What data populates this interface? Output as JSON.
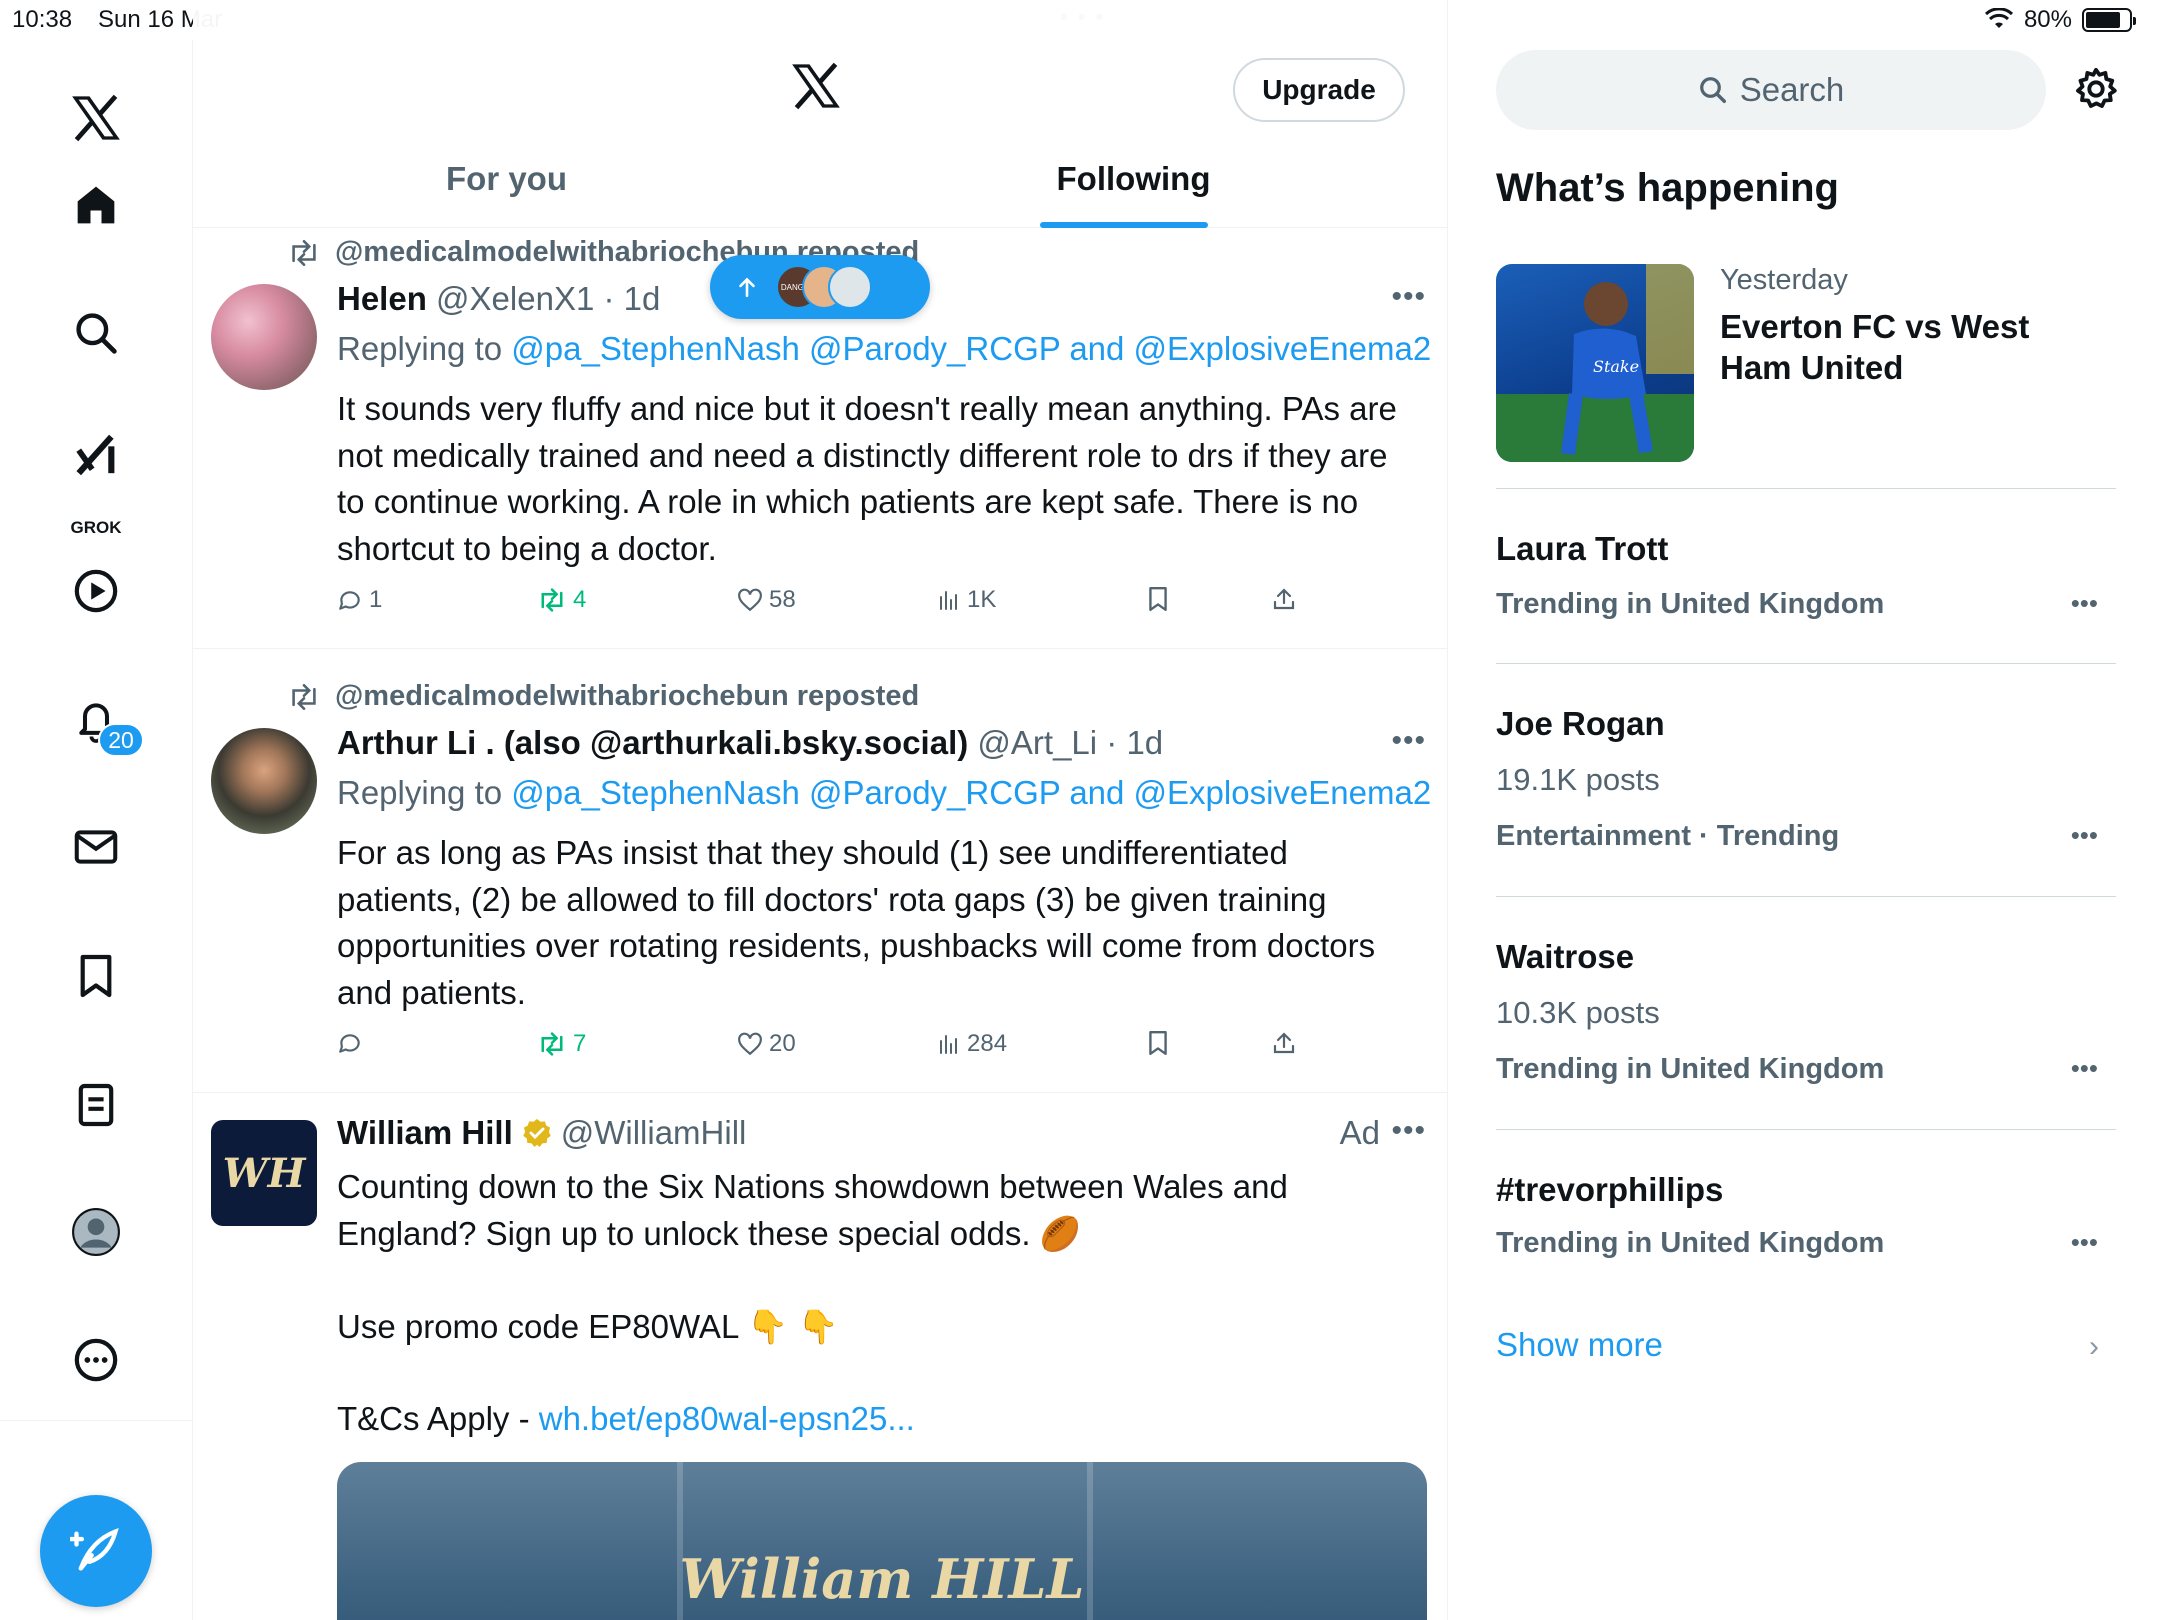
{
  "status_bar": {
    "time": "10:38",
    "date": "Sun 16 Mar",
    "battery": "80%",
    "battery_level": 0.8
  },
  "nav": {
    "items": [
      "x-logo",
      "home",
      "explore",
      "grok",
      "video",
      "notifications",
      "messages",
      "bookmarks",
      "lists",
      "profile",
      "more"
    ],
    "grok_label": "GROK",
    "notifications_count": "20"
  },
  "header": {
    "upgrade_label": "Upgrade",
    "tabs": [
      {
        "label": "For you",
        "active": false
      },
      {
        "label": "Following",
        "active": true
      }
    ]
  },
  "new_posts_pill": {
    "avatar_text": "DANGER"
  },
  "feed": [
    {
      "repost_line": "@medicalmodelwithabriochebun reposted",
      "name": "Helen",
      "handle": "@XelenX1",
      "time": "· 1d",
      "reply_prefix": "Replying to",
      "reply_to": "@pa_StephenNash @Parody_RCGP and @ExplosiveEnema2",
      "text": "It sounds very fluffy and nice but it doesn't really mean anything. PAs are not medically trained and need a distinctly different role to drs if they are to continue working. A role in which patients are kept safe. There is no shortcut to being a doctor.",
      "replies": "1",
      "reposts": "4",
      "likes": "58",
      "views": "1K"
    },
    {
      "repost_line": "@medicalmodelwithabriochebun reposted",
      "name": "Arthur Li . (also @arthurkali.bsky.social)",
      "handle": "@Art_Li",
      "time": "· 1d",
      "reply_prefix": "Replying to",
      "reply_to": "@pa_StephenNash @Parody_RCGP and @ExplosiveEnema2",
      "text": "For as long as PAs insist that they should (1) see undifferentiated patients, (2) be allowed to fill doctors' rota gaps (3) be given training opportunities over rotating residents, pushbacks will come from doctors and patients.",
      "replies": "",
      "reposts": "7",
      "likes": "20",
      "views": "284"
    },
    {
      "name": "William Hill",
      "handle": "@WilliamHill",
      "ad_label": "Ad",
      "avatar_text": "WH",
      "text_line1": "Counting down to the Six Nations showdown between Wales and England? Sign up to unlock these special odds. 🏉",
      "text_line2": "Use promo code EP80WAL 👇 👇",
      "text_line3_prefix": "T&Cs Apply - ",
      "text_line3_link": "wh.bet/ep80wal-epsn25...",
      "image_logo": "William HILL"
    }
  ],
  "sidebar": {
    "search_placeholder": "Search",
    "title": "What’s happening",
    "card": {
      "date": "Yesterday",
      "title": "Everton FC vs West Ham United",
      "shirt_text": "Stake"
    },
    "trends": [
      {
        "name": "Laura Trott",
        "posts": "",
        "context": "Trending in United Kingdom"
      },
      {
        "name": "Joe Rogan",
        "posts": "19.1K posts",
        "context": "Entertainment · Trending"
      },
      {
        "name": "Waitrose",
        "posts": "10.3K posts",
        "context": "Trending in United Kingdom"
      },
      {
        "name": "#trevorphillips",
        "posts": "",
        "context": "Trending in United Kingdom"
      }
    ],
    "show_more": "Show more"
  },
  "colors": {
    "accent": "#1d9bf0",
    "repost_green": "#00ba7c",
    "muted": "#536471"
  }
}
